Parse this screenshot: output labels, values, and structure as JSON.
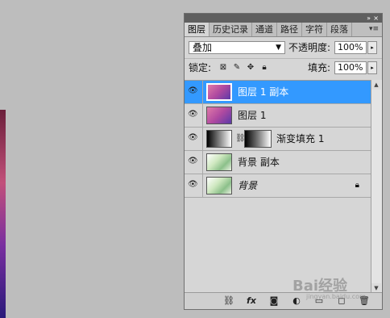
{
  "panel": {
    "tabs": [
      {
        "label": "图层",
        "active": true
      },
      {
        "label": "历史记录"
      },
      {
        "label": "通道"
      },
      {
        "label": "路径"
      },
      {
        "label": "字符"
      },
      {
        "label": "段落"
      }
    ],
    "collapse_icon": "double-chevron-right-icon",
    "close_icon": "close-icon",
    "menu_icon": "panel-menu-icon"
  },
  "blend_mode": {
    "value": "叠加"
  },
  "opacity": {
    "label": "不透明度:",
    "value": "100%"
  },
  "lock": {
    "label": "锁定:"
  },
  "fill": {
    "label": "填充:",
    "value": "100%"
  },
  "layers": [
    {
      "name": "图层 1 副本",
      "selected": true,
      "thumb": "gradient-photo"
    },
    {
      "name": "图层 1",
      "selected": false,
      "thumb": "gradient-photo"
    },
    {
      "name": "渐变填充 1",
      "selected": false,
      "thumb": "adjustment",
      "has_mask": true
    },
    {
      "name": "背景 副本",
      "selected": false,
      "thumb": "photo"
    },
    {
      "name": "背景",
      "selected": false,
      "thumb": "photo",
      "locked": true,
      "italic": true
    }
  ],
  "bottom_icons": [
    "link-layers-icon",
    "fx-icon",
    "mask-icon",
    "adjustment-icon",
    "group-icon",
    "new-layer-icon",
    "trash-icon"
  ],
  "watermark": {
    "text": "Bai经验",
    "sub": "jingyan.baidu.com"
  },
  "colors": {
    "selected": "#3399ff",
    "panel_bg": "#d6d6d6",
    "workspace": "#bdbdbd"
  }
}
